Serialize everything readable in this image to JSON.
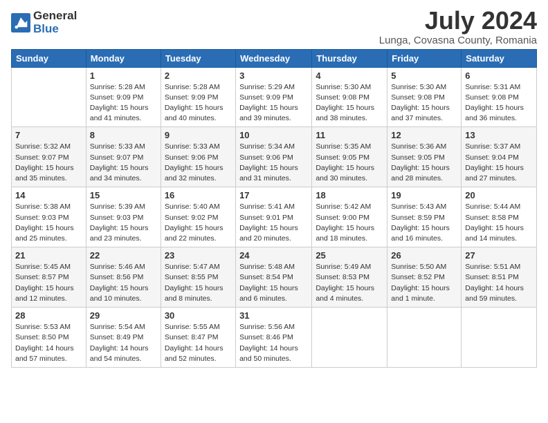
{
  "logo": {
    "general": "General",
    "blue": "Blue"
  },
  "title": "July 2024",
  "subtitle": "Lunga, Covasna County, Romania",
  "days_of_week": [
    "Sunday",
    "Monday",
    "Tuesday",
    "Wednesday",
    "Thursday",
    "Friday",
    "Saturday"
  ],
  "weeks": [
    [
      {
        "day": "",
        "info": ""
      },
      {
        "day": "1",
        "info": "Sunrise: 5:28 AM\nSunset: 9:09 PM\nDaylight: 15 hours\nand 41 minutes."
      },
      {
        "day": "2",
        "info": "Sunrise: 5:28 AM\nSunset: 9:09 PM\nDaylight: 15 hours\nand 40 minutes."
      },
      {
        "day": "3",
        "info": "Sunrise: 5:29 AM\nSunset: 9:09 PM\nDaylight: 15 hours\nand 39 minutes."
      },
      {
        "day": "4",
        "info": "Sunrise: 5:30 AM\nSunset: 9:08 PM\nDaylight: 15 hours\nand 38 minutes."
      },
      {
        "day": "5",
        "info": "Sunrise: 5:30 AM\nSunset: 9:08 PM\nDaylight: 15 hours\nand 37 minutes."
      },
      {
        "day": "6",
        "info": "Sunrise: 5:31 AM\nSunset: 9:08 PM\nDaylight: 15 hours\nand 36 minutes."
      }
    ],
    [
      {
        "day": "7",
        "info": "Sunrise: 5:32 AM\nSunset: 9:07 PM\nDaylight: 15 hours\nand 35 minutes."
      },
      {
        "day": "8",
        "info": "Sunrise: 5:33 AM\nSunset: 9:07 PM\nDaylight: 15 hours\nand 34 minutes."
      },
      {
        "day": "9",
        "info": "Sunrise: 5:33 AM\nSunset: 9:06 PM\nDaylight: 15 hours\nand 32 minutes."
      },
      {
        "day": "10",
        "info": "Sunrise: 5:34 AM\nSunset: 9:06 PM\nDaylight: 15 hours\nand 31 minutes."
      },
      {
        "day": "11",
        "info": "Sunrise: 5:35 AM\nSunset: 9:05 PM\nDaylight: 15 hours\nand 30 minutes."
      },
      {
        "day": "12",
        "info": "Sunrise: 5:36 AM\nSunset: 9:05 PM\nDaylight: 15 hours\nand 28 minutes."
      },
      {
        "day": "13",
        "info": "Sunrise: 5:37 AM\nSunset: 9:04 PM\nDaylight: 15 hours\nand 27 minutes."
      }
    ],
    [
      {
        "day": "14",
        "info": "Sunrise: 5:38 AM\nSunset: 9:03 PM\nDaylight: 15 hours\nand 25 minutes."
      },
      {
        "day": "15",
        "info": "Sunrise: 5:39 AM\nSunset: 9:03 PM\nDaylight: 15 hours\nand 23 minutes."
      },
      {
        "day": "16",
        "info": "Sunrise: 5:40 AM\nSunset: 9:02 PM\nDaylight: 15 hours\nand 22 minutes."
      },
      {
        "day": "17",
        "info": "Sunrise: 5:41 AM\nSunset: 9:01 PM\nDaylight: 15 hours\nand 20 minutes."
      },
      {
        "day": "18",
        "info": "Sunrise: 5:42 AM\nSunset: 9:00 PM\nDaylight: 15 hours\nand 18 minutes."
      },
      {
        "day": "19",
        "info": "Sunrise: 5:43 AM\nSunset: 8:59 PM\nDaylight: 15 hours\nand 16 minutes."
      },
      {
        "day": "20",
        "info": "Sunrise: 5:44 AM\nSunset: 8:58 PM\nDaylight: 15 hours\nand 14 minutes."
      }
    ],
    [
      {
        "day": "21",
        "info": "Sunrise: 5:45 AM\nSunset: 8:57 PM\nDaylight: 15 hours\nand 12 minutes."
      },
      {
        "day": "22",
        "info": "Sunrise: 5:46 AM\nSunset: 8:56 PM\nDaylight: 15 hours\nand 10 minutes."
      },
      {
        "day": "23",
        "info": "Sunrise: 5:47 AM\nSunset: 8:55 PM\nDaylight: 15 hours\nand 8 minutes."
      },
      {
        "day": "24",
        "info": "Sunrise: 5:48 AM\nSunset: 8:54 PM\nDaylight: 15 hours\nand 6 minutes."
      },
      {
        "day": "25",
        "info": "Sunrise: 5:49 AM\nSunset: 8:53 PM\nDaylight: 15 hours\nand 4 minutes."
      },
      {
        "day": "26",
        "info": "Sunrise: 5:50 AM\nSunset: 8:52 PM\nDaylight: 15 hours\nand 1 minute."
      },
      {
        "day": "27",
        "info": "Sunrise: 5:51 AM\nSunset: 8:51 PM\nDaylight: 14 hours\nand 59 minutes."
      }
    ],
    [
      {
        "day": "28",
        "info": "Sunrise: 5:53 AM\nSunset: 8:50 PM\nDaylight: 14 hours\nand 57 minutes."
      },
      {
        "day": "29",
        "info": "Sunrise: 5:54 AM\nSunset: 8:49 PM\nDaylight: 14 hours\nand 54 minutes."
      },
      {
        "day": "30",
        "info": "Sunrise: 5:55 AM\nSunset: 8:47 PM\nDaylight: 14 hours\nand 52 minutes."
      },
      {
        "day": "31",
        "info": "Sunrise: 5:56 AM\nSunset: 8:46 PM\nDaylight: 14 hours\nand 50 minutes."
      },
      {
        "day": "",
        "info": ""
      },
      {
        "day": "",
        "info": ""
      },
      {
        "day": "",
        "info": ""
      }
    ]
  ]
}
